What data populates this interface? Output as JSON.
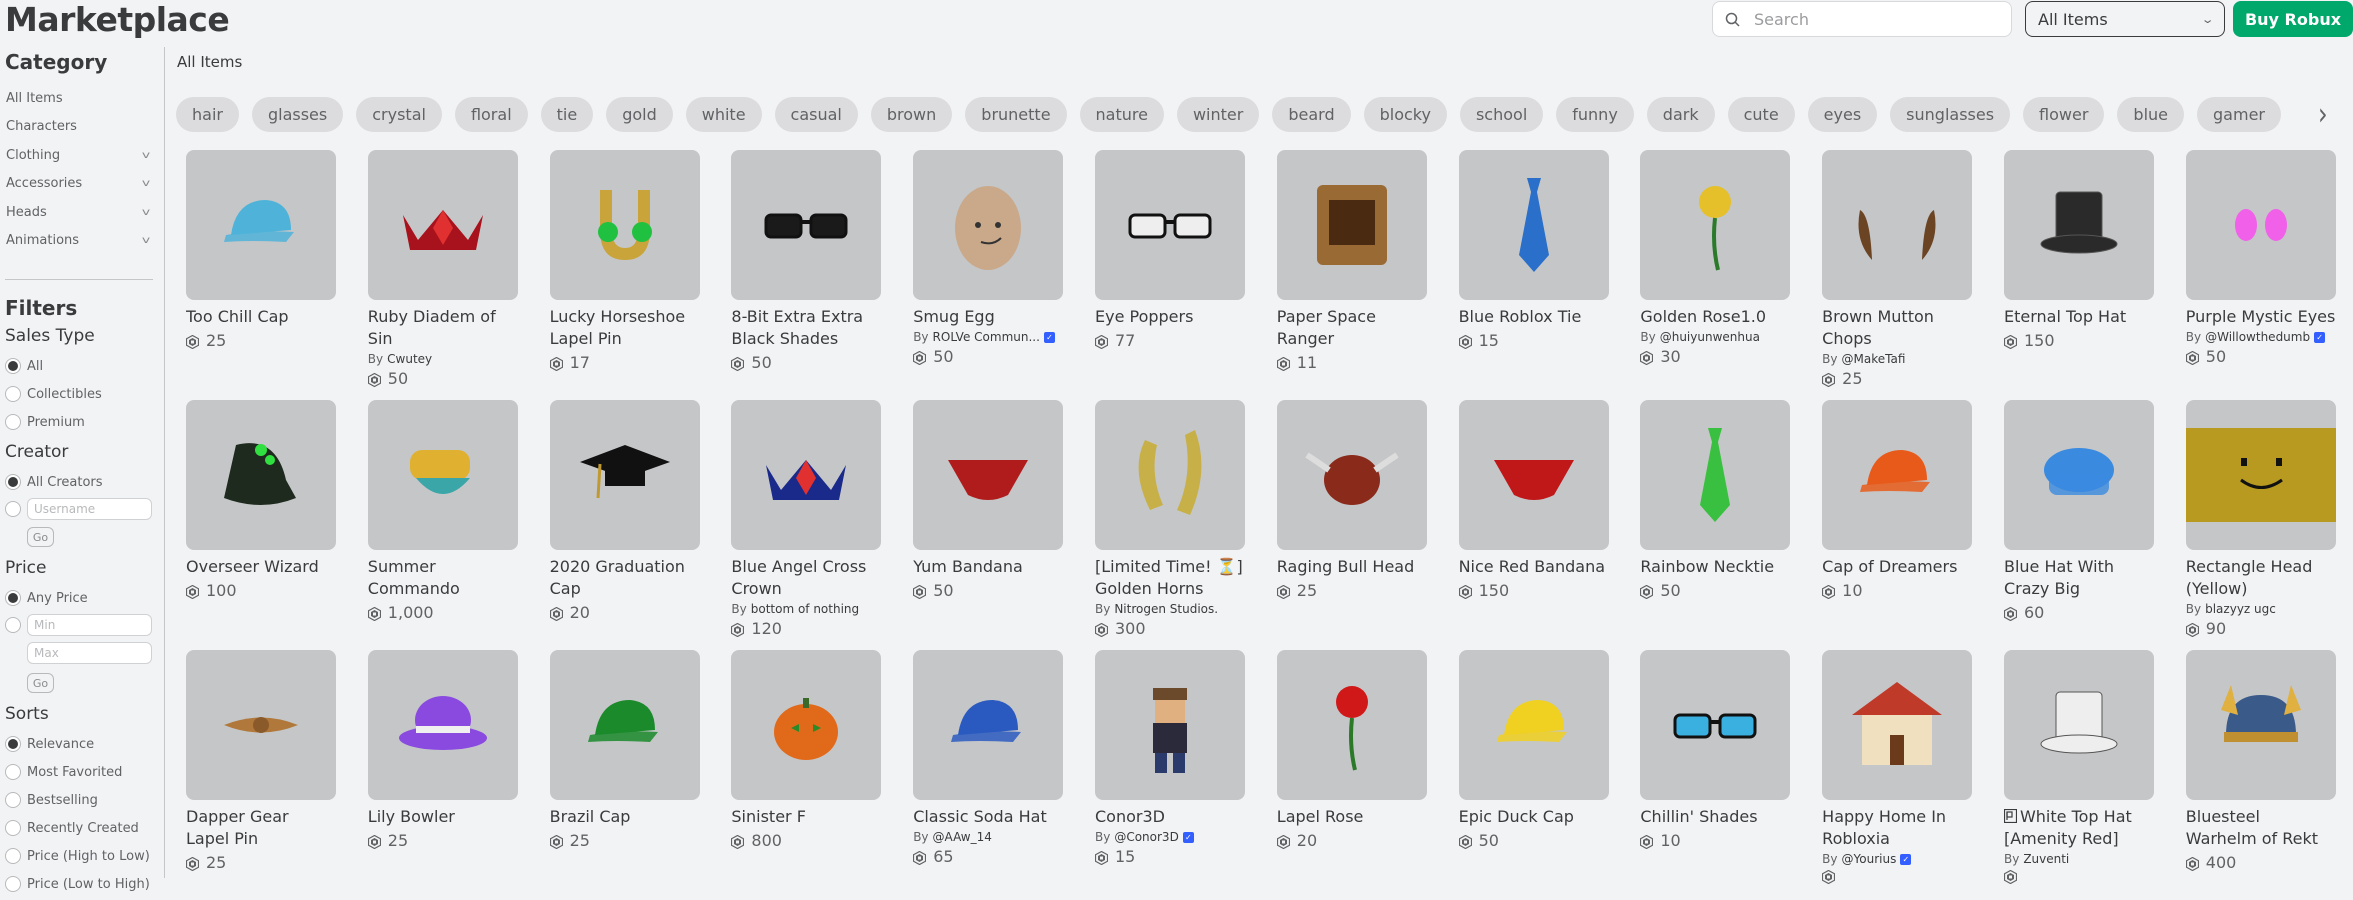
{
  "header": {
    "title": "Marketplace",
    "search_placeholder": "Search",
    "category_select": "All Items",
    "buy_robux": "Buy Robux"
  },
  "breadcrumb": "All Items",
  "sidebar": {
    "category_heading": "Category",
    "categories": [
      {
        "label": "All Items",
        "expandable": false
      },
      {
        "label": "Characters",
        "expandable": false
      },
      {
        "label": "Clothing",
        "expandable": true
      },
      {
        "label": "Accessories",
        "expandable": true
      },
      {
        "label": "Heads",
        "expandable": true
      },
      {
        "label": "Animations",
        "expandable": true
      }
    ],
    "filters_heading": "Filters",
    "sales_type": {
      "heading": "Sales Type",
      "options": [
        "All",
        "Collectibles",
        "Premium"
      ],
      "selected": "All"
    },
    "creator": {
      "heading": "Creator",
      "options": [
        "All Creators"
      ],
      "username_placeholder": "Username",
      "go": "Go",
      "selected": "All Creators"
    },
    "price": {
      "heading": "Price",
      "options": [
        "Any Price"
      ],
      "min_placeholder": "Min",
      "max_placeholder": "Max",
      "go": "Go",
      "selected": "Any Price"
    },
    "sorts": {
      "heading": "Sorts",
      "options": [
        "Relevance",
        "Most Favorited",
        "Bestselling",
        "Recently Created",
        "Price (High to Low)",
        "Price (Low to High)"
      ],
      "selected": "Relevance"
    }
  },
  "tags": [
    "hair",
    "glasses",
    "crystal",
    "floral",
    "tie",
    "gold",
    "white",
    "casual",
    "brown",
    "brunette",
    "nature",
    "winter",
    "beard",
    "blocky",
    "school",
    "funny",
    "dark",
    "cute",
    "eyes",
    "sunglasses",
    "flower",
    "blue",
    "gamer"
  ],
  "items": [
    {
      "name": "Too Chill Cap",
      "creator": null,
      "verified": false,
      "price": "25",
      "icon": "cap-icon",
      "color": "#4fb3d9"
    },
    {
      "name": "Ruby Diadem of Sin",
      "creator": "Cwutey",
      "verified": false,
      "price": "50",
      "icon": "crown-icon",
      "color": "#a8121c"
    },
    {
      "name": "Lucky Horseshoe Lapel Pin",
      "creator": null,
      "verified": false,
      "price": "17",
      "icon": "horseshoe-icon",
      "color": "#c9a43a"
    },
    {
      "name": "8-Bit Extra Extra Black Shades",
      "creator": null,
      "verified": false,
      "price": "50",
      "icon": "glasses-icon",
      "color": "#1a1a1a"
    },
    {
      "name": "Smug Egg",
      "creator": "ROLVe Commun...",
      "verified": true,
      "price": "50",
      "icon": "egg-icon",
      "color": "#c9a98a"
    },
    {
      "name": "Eye Poppers",
      "creator": null,
      "verified": false,
      "price": "77",
      "icon": "glasses-icon",
      "color": "#eeeeee"
    },
    {
      "name": "Paper Space Ranger",
      "creator": null,
      "verified": false,
      "price": "11",
      "icon": "box-icon",
      "color": "#9a6a35"
    },
    {
      "name": "Blue Roblox Tie",
      "creator": null,
      "verified": false,
      "price": "15",
      "icon": "tie-icon",
      "color": "#2a6fc9"
    },
    {
      "name": "Golden Rose1.0",
      "creator": "@huiyunwenhua",
      "verified": false,
      "price": "30",
      "icon": "rose-icon",
      "color": "#e5c02a"
    },
    {
      "name": "Brown Mutton Chops",
      "creator": "@MakeTafi",
      "verified": false,
      "price": "25",
      "icon": "hair-icon",
      "color": "#6b4423"
    },
    {
      "name": "Eternal Top Hat",
      "creator": null,
      "verified": false,
      "price": "150",
      "icon": "tophat-icon",
      "color": "#2a2a2a"
    },
    {
      "name": "Purple Mystic Eyes",
      "creator": "@Willowthedumb",
      "verified": true,
      "price": "50",
      "icon": "eyes-icon",
      "color": "#f060e8"
    },
    {
      "name": "Overseer Wizard",
      "creator": null,
      "verified": false,
      "price": "100",
      "icon": "wizard-hat-icon",
      "color": "#1f2a1f"
    },
    {
      "name": "Summer Commando",
      "creator": null,
      "verified": false,
      "price": "1,000",
      "icon": "mask-icon",
      "color": "#3aa6a8"
    },
    {
      "name": "2020 Graduation Cap",
      "creator": null,
      "verified": false,
      "price": "20",
      "icon": "grad-cap-icon",
      "color": "#111111"
    },
    {
      "name": "Blue Angel Cross Crown",
      "creator": "bottom of nothing",
      "verified": false,
      "price": "120",
      "icon": "crown-icon",
      "color": "#1a2a8a"
    },
    {
      "name": "Yum Bandana",
      "creator": null,
      "verified": false,
      "price": "50",
      "icon": "bandana-icon",
      "color": "#b01c1c"
    },
    {
      "name": "[Limited Time! ⏳] Golden Horns",
      "creator": "Nitrogen Studios.",
      "verified": false,
      "price": "300",
      "icon": "horns-icon",
      "color": "#c8b048"
    },
    {
      "name": "Raging Bull Head",
      "creator": null,
      "verified": false,
      "price": "25",
      "icon": "bull-icon",
      "color": "#8a2a1a"
    },
    {
      "name": "Nice Red Bandana",
      "creator": null,
      "verified": false,
      "price": "150",
      "icon": "bandana-icon",
      "color": "#c01818"
    },
    {
      "name": "Rainbow Necktie",
      "creator": null,
      "verified": false,
      "price": "50",
      "icon": "tie-icon",
      "color": "#3ac040"
    },
    {
      "name": "Cap of Dreamers",
      "creator": null,
      "verified": false,
      "price": "10",
      "icon": "cap-icon",
      "color": "#e85a1a"
    },
    {
      "name": "Blue Hat With Crazy Big",
      "creator": null,
      "verified": false,
      "price": "60",
      "icon": "hat-icon",
      "color": "#3a8ae0"
    },
    {
      "name": "Rectangle Head (Yellow)",
      "creator": "blazyyz ugc",
      "verified": false,
      "price": "90",
      "icon": "face-icon",
      "color": "#b89a20"
    },
    {
      "name": "Dapper Gear Lapel Pin",
      "creator": null,
      "verified": false,
      "price": "25",
      "icon": "pin-icon",
      "color": "#b0783a"
    },
    {
      "name": "Lily Bowler",
      "creator": null,
      "verified": false,
      "price": "25",
      "icon": "bowler-icon",
      "color": "#8a4ae0"
    },
    {
      "name": "Brazil Cap",
      "creator": null,
      "verified": false,
      "price": "25",
      "icon": "cap-icon",
      "color": "#1a8a2a"
    },
    {
      "name": "Sinister F",
      "creator": null,
      "verified": false,
      "price": "800",
      "icon": "pumpkin-icon",
      "color": "#e06a1a"
    },
    {
      "name": "Classic Soda Hat",
      "creator": "@AAw_14",
      "verified": false,
      "price": "65",
      "icon": "cap-icon",
      "color": "#2a5ac0"
    },
    {
      "name": "Conor3D",
      "creator": "@Conor3D",
      "verified": true,
      "price": "15",
      "icon": "avatar-icon",
      "color": "#6a4a2a"
    },
    {
      "name": "Lapel Rose",
      "creator": null,
      "verified": false,
      "price": "20",
      "icon": "rose-icon",
      "color": "#d01818"
    },
    {
      "name": "Epic Duck Cap",
      "creator": null,
      "verified": false,
      "price": "50",
      "icon": "cap-icon",
      "color": "#f0d020"
    },
    {
      "name": "Chillin' Shades",
      "creator": null,
      "verified": false,
      "price": "10",
      "icon": "glasses-icon",
      "color": "#3ab0e0"
    },
    {
      "name": "Happy Home In Robloxia",
      "creator": "@Yourius",
      "verified": true,
      "price": "",
      "icon": "house-icon",
      "color": "#c03a2a"
    },
    {
      "name": "White Top Hat [Amenity Red]",
      "creator": "Zuventi",
      "verified": false,
      "price": "",
      "icon": "tophat-icon",
      "color": "#eeeeee",
      "limited_badge": true
    },
    {
      "name": "Bluesteel Warhelm of Rekt",
      "creator": null,
      "verified": false,
      "price": "400",
      "icon": "helmet-icon",
      "color": "#3a5a8a"
    }
  ],
  "colors": {
    "accent_green": "#00a86b",
    "verified_blue": "#335fff",
    "background": "#f2f3f5",
    "thumb_bg": "#c5c6c8"
  }
}
